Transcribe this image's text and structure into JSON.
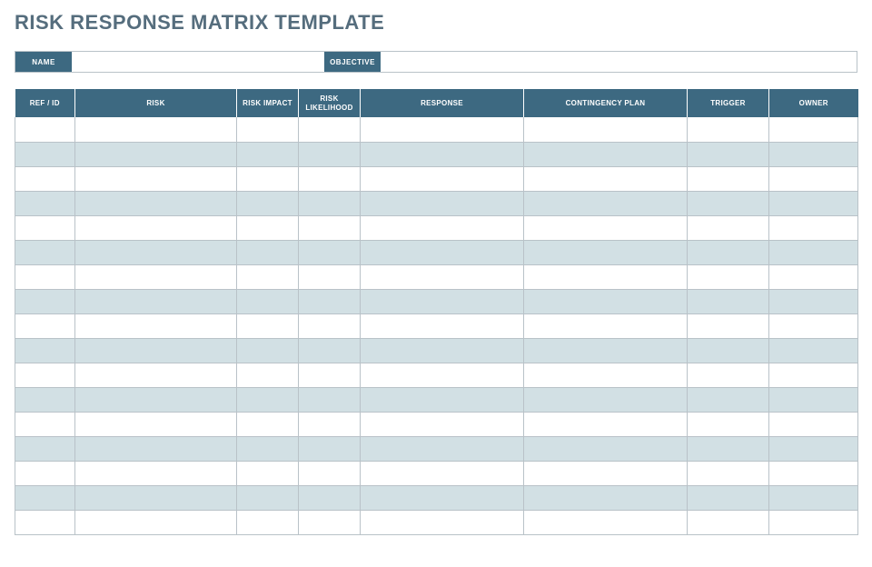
{
  "title": "RISK RESPONSE MATRIX TEMPLATE",
  "info": {
    "name_label": "NAME",
    "name_value": "",
    "objective_label": "OBJECTIVE",
    "objective_value": ""
  },
  "columns": [
    "REF / ID",
    "RISK",
    "RISK IMPACT",
    "RISK LIKELIHOOD",
    "RESPONSE",
    "CONTINGENCY PLAN",
    "TRIGGER",
    "OWNER"
  ],
  "rows": [
    [
      "",
      "",
      "",
      "",
      "",
      "",
      "",
      ""
    ],
    [
      "",
      "",
      "",
      "",
      "",
      "",
      "",
      ""
    ],
    [
      "",
      "",
      "",
      "",
      "",
      "",
      "",
      ""
    ],
    [
      "",
      "",
      "",
      "",
      "",
      "",
      "",
      ""
    ],
    [
      "",
      "",
      "",
      "",
      "",
      "",
      "",
      ""
    ],
    [
      "",
      "",
      "",
      "",
      "",
      "",
      "",
      ""
    ],
    [
      "",
      "",
      "",
      "",
      "",
      "",
      "",
      ""
    ],
    [
      "",
      "",
      "",
      "",
      "",
      "",
      "",
      ""
    ],
    [
      "",
      "",
      "",
      "",
      "",
      "",
      "",
      ""
    ],
    [
      "",
      "",
      "",
      "",
      "",
      "",
      "",
      ""
    ],
    [
      "",
      "",
      "",
      "",
      "",
      "",
      "",
      ""
    ],
    [
      "",
      "",
      "",
      "",
      "",
      "",
      "",
      ""
    ],
    [
      "",
      "",
      "",
      "",
      "",
      "",
      "",
      ""
    ],
    [
      "",
      "",
      "",
      "",
      "",
      "",
      "",
      ""
    ],
    [
      "",
      "",
      "",
      "",
      "",
      "",
      "",
      ""
    ],
    [
      "",
      "",
      "",
      "",
      "",
      "",
      "",
      ""
    ],
    [
      "",
      "",
      "",
      "",
      "",
      "",
      "",
      ""
    ]
  ]
}
